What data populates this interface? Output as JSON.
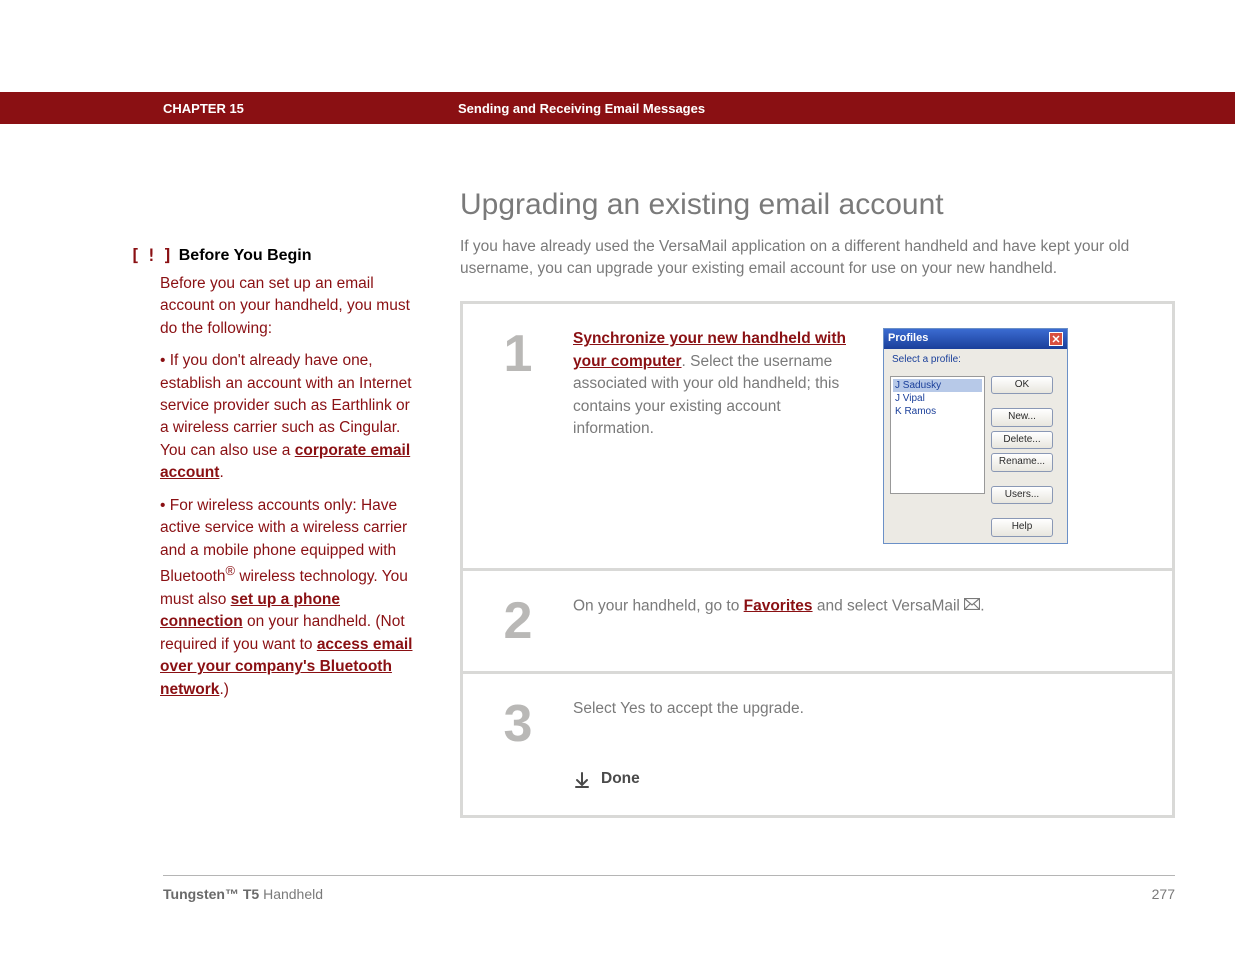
{
  "header": {
    "chapter": "CHAPTER 15",
    "title": "Sending and Receiving Email Messages"
  },
  "sidebar": {
    "byb_bracket_open": "[",
    "byb_mark": "!",
    "byb_bracket_close": "]",
    "byb_title": "Before You Begin",
    "intro": "Before you can set up an email account on your handheld, you must do the following:",
    "bullet1_pre": "•  If you don't already have one, establish an account with an Internet service provider such as Earthlink or a wireless carrier such as Cingular. You can also use a ",
    "bullet1_link": "corporate email account",
    "bullet1_post": ".",
    "bullet2_pre": "•  For wireless accounts only: Have active service with a wireless carrier and a mobile phone equipped with Bluetooth",
    "bullet2_reg": "®",
    "bullet2_mid": " wireless technology. You must also ",
    "bullet2_link1": "set up a phone connection",
    "bullet2_mid2": " on your handheld. (Not required if you want to ",
    "bullet2_link2": "access email over your company's Bluetooth network",
    "bullet2_post": ".)"
  },
  "main": {
    "heading": "Upgrading an existing email account",
    "intro": "If you have already used the VersaMail application on a different handheld and have kept your old username, you can upgrade your existing email account for use on your new handheld."
  },
  "steps": {
    "s1": {
      "num": "1",
      "link": "Synchronize your new handheld with your computer",
      "rest": ". Select the username associated with your old handheld; this contains your existing account information."
    },
    "s2": {
      "num": "2",
      "pre": "On your handheld, go to ",
      "link": "Favorites",
      "post": " and select VersaMail "
    },
    "s3": {
      "num": "3",
      "text": "Select Yes to accept the upgrade.",
      "done": "Done"
    }
  },
  "dialog": {
    "title": "Profiles",
    "select_label": "Select a profile:",
    "items": [
      "J Sadusky",
      "J Vipal",
      "K Ramos"
    ],
    "buttons": {
      "ok": "OK",
      "new": "New...",
      "delete": "Delete...",
      "rename": "Rename...",
      "users": "Users...",
      "help": "Help"
    }
  },
  "footer": {
    "product_bold": "Tungsten™ T5",
    "product_rest": " Handheld",
    "page": "277"
  }
}
